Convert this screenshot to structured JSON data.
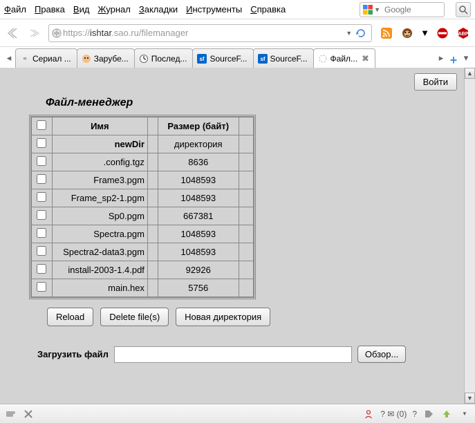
{
  "menu": {
    "file": "Файл",
    "edit": "Правка",
    "view": "Вид",
    "history": "Журнал",
    "bookmarks": "Закладки",
    "tools": "Инструменты",
    "help": "Справка"
  },
  "search": {
    "placeholder": "Google"
  },
  "url": {
    "scheme": "https://",
    "host": "ishtar",
    "rest": ".sao.ru/filemanager"
  },
  "tabs": [
    {
      "label": "Сериал ..."
    },
    {
      "label": "Зарубе..."
    },
    {
      "label": "Послед..."
    },
    {
      "label": "SourceF..."
    },
    {
      "label": "SourceF..."
    },
    {
      "label": "Файл..."
    }
  ],
  "loginBtn": "Войти",
  "fm": {
    "title": "Файл-менеджер",
    "headers": {
      "name": "Имя",
      "size": "Размер (байт)"
    },
    "rows": [
      {
        "name": "newDir",
        "size": "директория"
      },
      {
        "name": ".config.tgz",
        "size": "8636"
      },
      {
        "name": "Frame3.pgm",
        "size": "1048593"
      },
      {
        "name": "Frame_sp2-1.pgm",
        "size": "1048593"
      },
      {
        "name": "Sp0.pgm",
        "size": "667381"
      },
      {
        "name": "Spectra.pgm",
        "size": "1048593"
      },
      {
        "name": "Spectra2-data3.pgm",
        "size": "1048593"
      },
      {
        "name": "install-2003-1.4.pdf",
        "size": "92926"
      },
      {
        "name": "main.hex",
        "size": "5756"
      }
    ],
    "buttons": {
      "reload": "Reload",
      "delete": "Delete file(s)",
      "newdir": "Новая директория"
    },
    "upload": {
      "label": "Загрузить файл",
      "browse": "Обзор..."
    }
  },
  "status": {
    "mail": "? ✉ (0)",
    "q2": "?"
  }
}
